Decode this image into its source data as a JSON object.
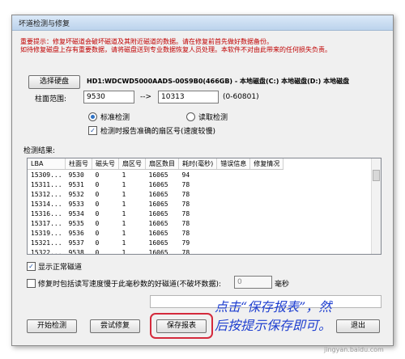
{
  "window": {
    "title": "坏道检测与修复"
  },
  "notice": {
    "line1": "重要提示：修复坏磁道会破坏磁道及其附近磁道的数据。请在修复前首先做好数据备份。",
    "line2": "如待修复磁盘上存有重要数据，请将磁盘送到专业数据恢复人员处理。本软件不对由此带来的任何损失负责。"
  },
  "disk": {
    "select_label": "选择硬盘",
    "info": "HD1:WDCWD5000AADS-00S9B0(466GB) - 本地磁盘(C:) 本地磁盘(D:) 本地磁盘"
  },
  "range": {
    "label": "柱面范围:",
    "from": "9530",
    "arrow": "-->",
    "to": "10313",
    "hint": "(0-60801)"
  },
  "options": {
    "standard_label": "标准检测",
    "read_label": "读取检测",
    "report_sector_label": "检测时报告准确的扇区号(速度较慢)"
  },
  "results": {
    "label": "检测结果:",
    "columns": [
      "LBA",
      "柱面号",
      "磁头号",
      "扇区号",
      "扇区数目",
      "耗时(毫秒)",
      "错误信息",
      "修复情况"
    ],
    "rows": [
      [
        "15309...",
        "9530",
        "0",
        "1",
        "16065",
        "94",
        "",
        ""
      ],
      [
        "15311...",
        "9531",
        "0",
        "1",
        "16065",
        "78",
        "",
        ""
      ],
      [
        "15312...",
        "9532",
        "0",
        "1",
        "16065",
        "78",
        "",
        ""
      ],
      [
        "15314...",
        "9533",
        "0",
        "1",
        "16065",
        "78",
        "",
        ""
      ],
      [
        "15316...",
        "9534",
        "0",
        "1",
        "16065",
        "78",
        "",
        ""
      ],
      [
        "15317...",
        "9535",
        "0",
        "1",
        "16065",
        "78",
        "",
        ""
      ],
      [
        "15319...",
        "9536",
        "0",
        "1",
        "16065",
        "78",
        "",
        ""
      ],
      [
        "15321...",
        "9537",
        "0",
        "1",
        "16065",
        "79",
        "",
        ""
      ],
      [
        "15322...",
        "9538",
        "0",
        "1",
        "16065",
        "78",
        "",
        ""
      ]
    ]
  },
  "show_normal": {
    "label": "显示正常磁道"
  },
  "repair_slow": {
    "label": "修复时包括读写速度慢于此毫秒数的好磁道(不破坏数据):",
    "value": "0",
    "unit": "毫秒"
  },
  "buttons": {
    "start": "开始检测",
    "try_repair": "尝试修复",
    "save_report": "保存报表",
    "exit": "退出"
  },
  "annotation": {
    "line1": "点击“保存报表”，然",
    "line2": "后按提示保存即可。"
  },
  "watermark": "jingyan.baidu.com"
}
